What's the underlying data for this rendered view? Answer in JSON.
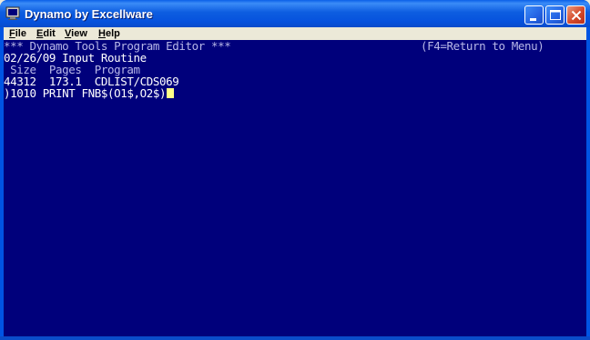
{
  "window": {
    "title": "Dynamo by Excellware",
    "icon": "terminal-app-icon",
    "controls": [
      "minimize-icon",
      "maximize-icon",
      "close-icon"
    ]
  },
  "menubar": {
    "items": [
      {
        "label": "File",
        "underline": "F"
      },
      {
        "label": "Edit",
        "underline": "E"
      },
      {
        "label": "View",
        "underline": "V"
      },
      {
        "label": "Help",
        "underline": "H"
      }
    ]
  },
  "terminal": {
    "header_left": "*** Dynamo Tools Program Editor ***",
    "header_right": "(F4=Return to Menu)",
    "line2": "02/26/09 Input Routine",
    "col_headers": " Size  Pages  Program",
    "row_values": "44312  173.1  CDLIST/CDS069",
    "edit_line": ")1010 PRINT FNB$(O1$,O2$)"
  },
  "colors": {
    "terminal_bg": "#00007B",
    "text": "#FFFFFF",
    "cursor": "#FFFF88",
    "titlebar": "#0054E3"
  }
}
